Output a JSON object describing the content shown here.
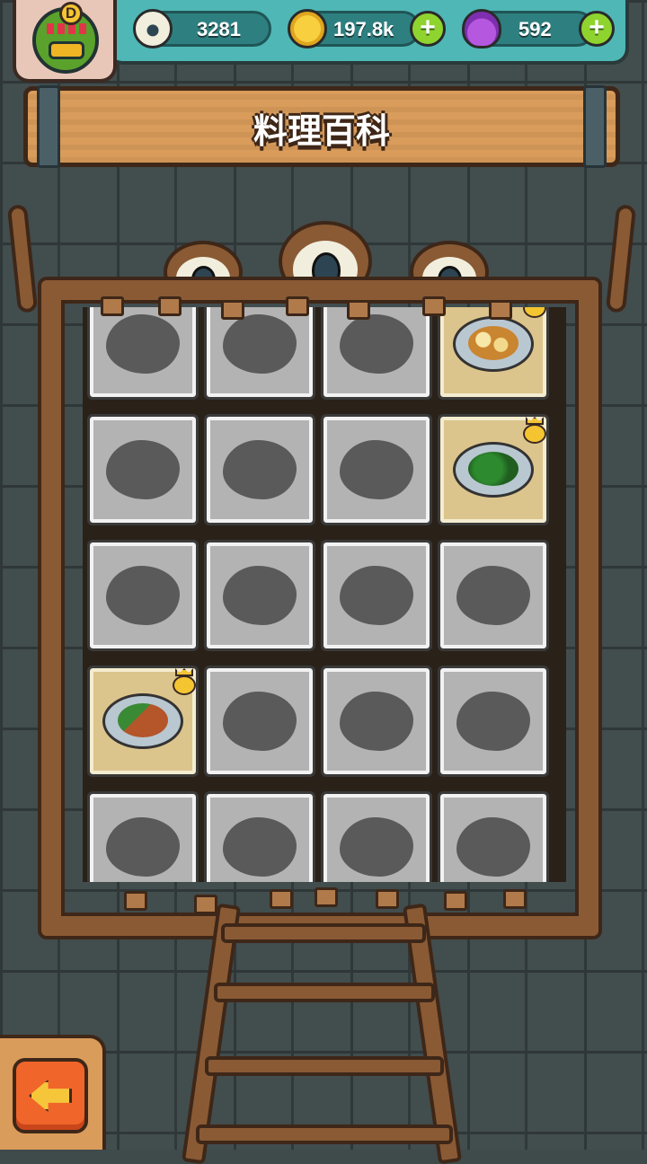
{
  "header": {
    "avatar": {
      "rank_badge": "D",
      "icon": "monster-avatar-icon"
    },
    "resources": [
      {
        "name": "eyeballs",
        "icon": "eyeball-icon",
        "value": "3281",
        "has_add": false
      },
      {
        "name": "coins",
        "icon": "coin-icon",
        "value": "197.8k",
        "has_add": true
      },
      {
        "name": "potions",
        "icon": "potion-icon",
        "value": "592",
        "has_add": true
      }
    ]
  },
  "title": "料理百科",
  "encyclopedia": {
    "rows": [
      [
        {
          "state": "locked"
        },
        {
          "state": "locked"
        },
        {
          "state": "locked"
        },
        {
          "state": "unlocked",
          "dish": "fried-egg-plate",
          "crowned": true
        }
      ],
      [
        {
          "state": "locked"
        },
        {
          "state": "locked"
        },
        {
          "state": "locked"
        },
        {
          "state": "unlocked",
          "dish": "green-vegetable-plate",
          "crowned": true
        }
      ],
      [
        {
          "state": "locked"
        },
        {
          "state": "locked"
        },
        {
          "state": "locked"
        },
        {
          "state": "locked"
        }
      ],
      [
        {
          "state": "unlocked",
          "dish": "steak-with-greens",
          "crowned": true
        },
        {
          "state": "locked"
        },
        {
          "state": "locked"
        },
        {
          "state": "locked"
        }
      ],
      [
        {
          "state": "locked"
        },
        {
          "state": "locked"
        },
        {
          "state": "locked"
        },
        {
          "state": "locked"
        }
      ]
    ]
  },
  "colors": {
    "wall": "#424d4e",
    "topbar": "#4fb7b5",
    "wood": "#8a5a34",
    "plank": "#d99c5b",
    "locked_cell": "#b3b3b3",
    "unlocked_cell": "#dcc48d",
    "back_button": "#f0652a",
    "add_button": "#8fd32f"
  },
  "footer": {
    "back_button_icon": "back-arrow-icon"
  }
}
